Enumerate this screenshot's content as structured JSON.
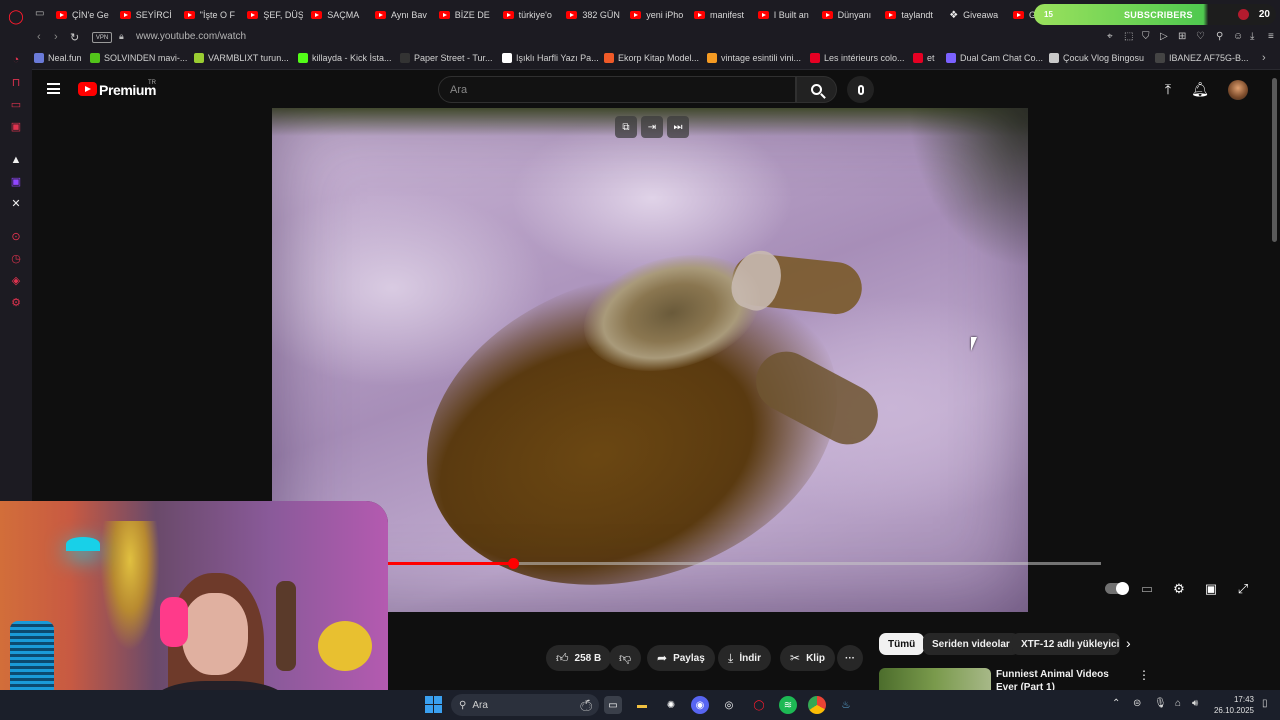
{
  "browser": {
    "tabs": [
      {
        "label": "ÇİN'e Ge",
        "icon": "youtube-icon"
      },
      {
        "label": "SEYİRCİ",
        "icon": "youtube-icon"
      },
      {
        "label": "''İşte O F",
        "icon": "youtube-icon"
      },
      {
        "label": "ŞEF, DÜŞ",
        "icon": "youtube-icon"
      },
      {
        "label": "SAÇMA",
        "icon": "youtube-icon"
      },
      {
        "label": "Aynı Bav",
        "icon": "youtube-icon"
      },
      {
        "label": "BİZE DE",
        "icon": "youtube-icon"
      },
      {
        "label": "türkiye'o",
        "icon": "youtube-icon"
      },
      {
        "label": "382 GÜN",
        "icon": "youtube-icon"
      },
      {
        "label": "yeni iPho",
        "icon": "youtube-icon"
      },
      {
        "label": "manifest",
        "icon": "youtube-icon"
      },
      {
        "label": "I Built an",
        "icon": "youtube-icon"
      },
      {
        "label": "Dünyanı",
        "icon": "youtube-icon"
      },
      {
        "label": "taylandt",
        "icon": "youtube-icon"
      },
      {
        "label": "Giveawa",
        "icon": "gift-icon"
      },
      {
        "label": "G",
        "icon": "youtube-icon"
      }
    ],
    "url": "www.youtube.com/watch",
    "vpn_label": "VPN",
    "bookmarks": [
      {
        "label": "Neal.fun",
        "color": "#6a7ad8"
      },
      {
        "label": "SOLVINDEN mavi-...",
        "color": "#52c41a"
      },
      {
        "label": "VARMBLIXT turun...",
        "color": "#9acd32"
      },
      {
        "label": "killayda - Kick İsta...",
        "color": "#53fc18"
      },
      {
        "label": "Paper Street - Tur...",
        "color": "#333333"
      },
      {
        "label": "Işıklı Harfli Yazı Pa...",
        "color": "#ffffff"
      },
      {
        "label": "Ekorp Kitap Model...",
        "color": "#f05a28"
      },
      {
        "label": "vintage esintili vini...",
        "color": "#f59b23"
      },
      {
        "label": "Les intérieurs colo...",
        "color": "#e60023"
      },
      {
        "label": "et",
        "color": "#e60023"
      },
      {
        "label": "Dual Cam Chat Co...",
        "color": "#7b61ff"
      },
      {
        "label": "Çocuk Vlog Bingosu",
        "color": "#c9c9c9"
      },
      {
        "label": "IBANEZ AF75G-B...",
        "color": "#444444"
      }
    ]
  },
  "overlay": {
    "count_left": "15",
    "label": "SUBSCRIBERS",
    "count_right": "20"
  },
  "youtube": {
    "brand": "Premium",
    "region": "TR",
    "search_placeholder": "Ara",
    "video": {
      "progress_fraction": 0.176
    },
    "actions": {
      "like_count": "258 B",
      "share": "Paylaş",
      "download": "İndir",
      "clip": "Klip",
      "more": "···"
    },
    "chips": [
      {
        "label": "Tümü",
        "active": true
      },
      {
        "label": "Seriden videolar",
        "active": false
      },
      {
        "label": "XTF-12 adlı yükleyici",
        "active": false
      }
    ],
    "recommendation": {
      "title": "Funniest Animal Videos Ever (Part 1)"
    }
  },
  "taskbar": {
    "search_label": "Ara",
    "time": "17:43",
    "date": "26.10.2025"
  },
  "colors": {
    "accent": "#ff0000",
    "background": "#0f0f0f"
  }
}
